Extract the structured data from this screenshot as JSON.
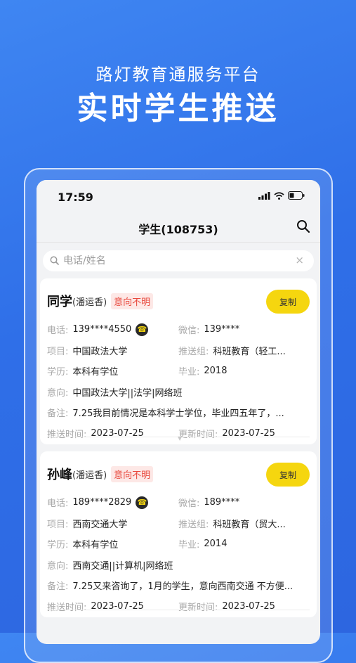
{
  "promo": {
    "subtitle": "路灯教育通服务平台",
    "title": "实时学生推送"
  },
  "status_bar": {
    "time": "17:59"
  },
  "nav": {
    "title": "学生(108753)",
    "search_icon": "search-icon"
  },
  "search": {
    "placeholder": "电话/姓名",
    "clear_label": "×"
  },
  "labels": {
    "phone": "电话:",
    "wechat": "微信:",
    "project": "项目:",
    "push_group": "推送组:",
    "education": "学历:",
    "graduation": "毕业:",
    "intent": "意向:",
    "note": "备注:",
    "push_time": "推送时间:",
    "update_time": "更新时间:"
  },
  "students": [
    {
      "name": "同学",
      "agent": "(潘运香)",
      "intent_status": "意向不明",
      "copy_label": "复制",
      "phone": "139****4550",
      "wechat": "139****",
      "project": "中国政法大学",
      "push_group": "科班教育（轻工...",
      "education": "本科有学位",
      "graduation": "2018",
      "intent": "中国政法大学||法学|网络班",
      "note": "7.25我目前情况是本科学士学位，毕业四五年了，...",
      "push_time": "2023-07-25",
      "update_time": "2023-07-25"
    },
    {
      "name": "孙峰",
      "agent": "(潘运香)",
      "intent_status": "意向不明",
      "copy_label": "复制",
      "phone": "189****2829",
      "wechat": "189****",
      "project": "西南交通大学",
      "push_group": "科班教育（贸大...",
      "education": "本科有学位",
      "graduation": "2014",
      "intent": "西南交通||计算机|网络班",
      "note": "7.25又来咨询了，1月的学生，意向西南交通 不方便...",
      "push_time": "2023-07-25",
      "update_time": "2023-07-25"
    }
  ],
  "colors": {
    "background": "#3f86f2",
    "accent_yellow": "#f5d60f",
    "badge_red": "#e8473c"
  }
}
